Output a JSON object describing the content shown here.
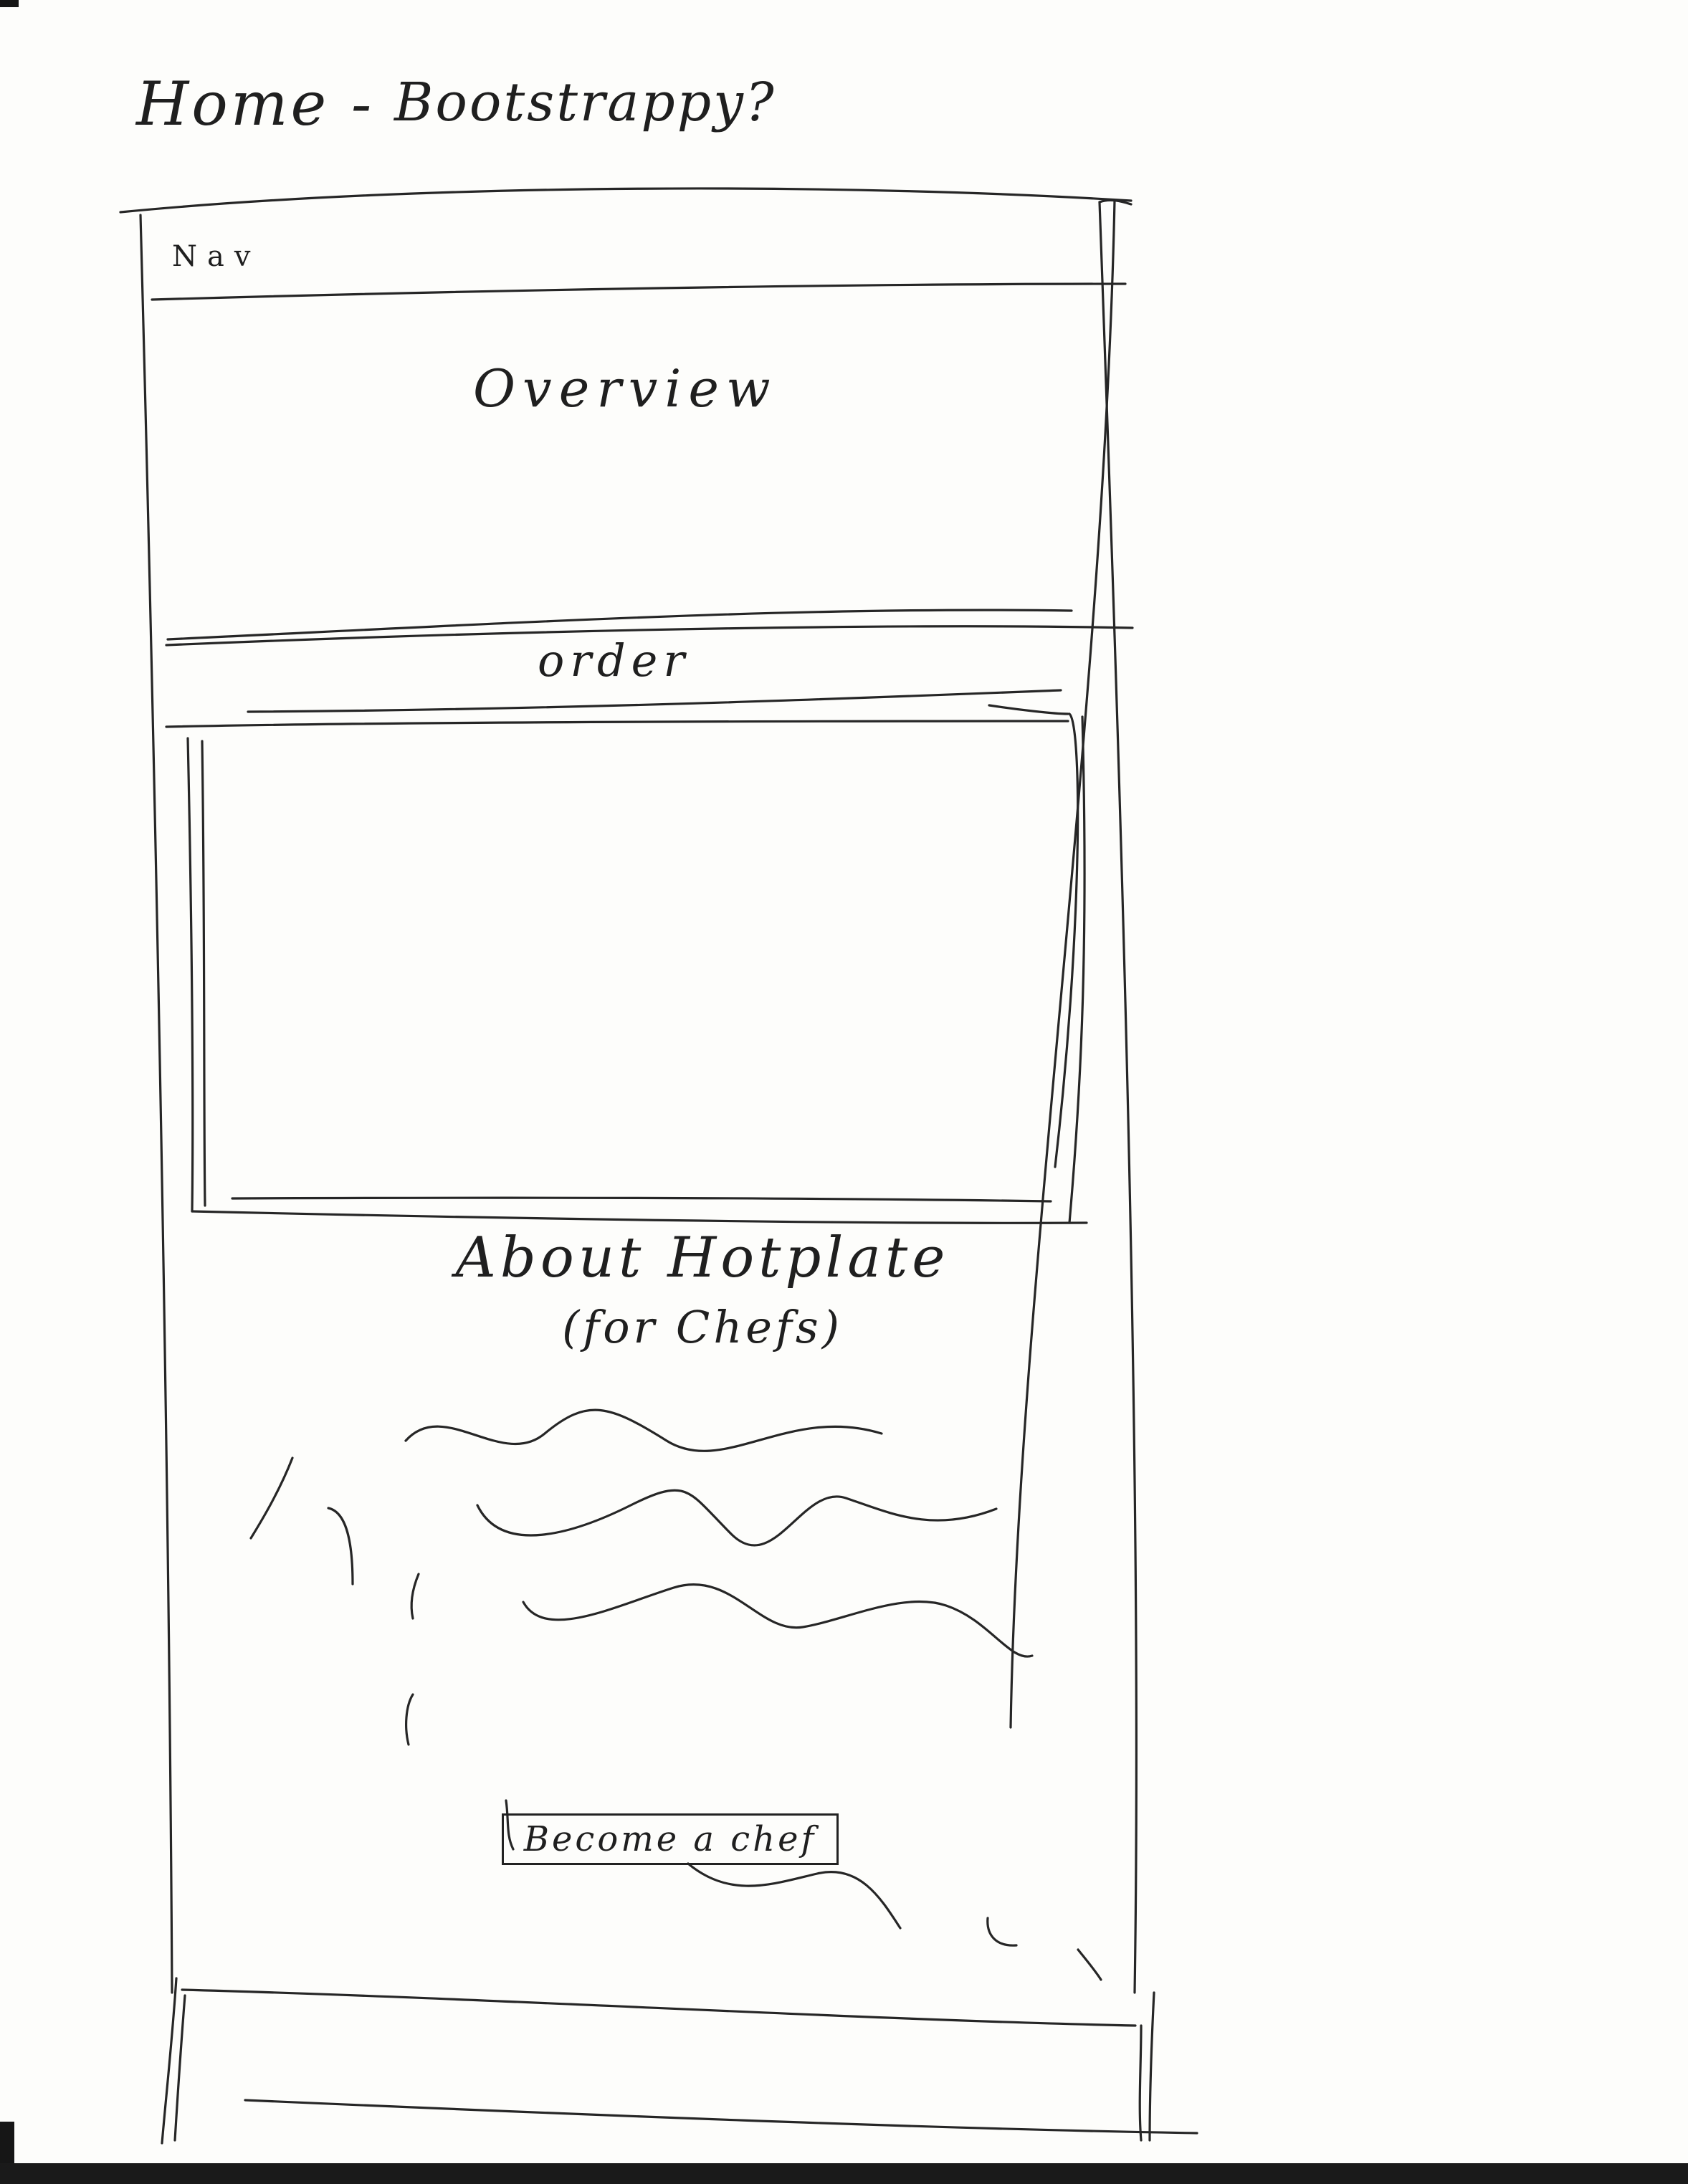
{
  "header": {
    "title": "Home -",
    "subtitle": "Bootstrappy?"
  },
  "nav": {
    "label": "Nav"
  },
  "overview": {
    "label": "Overview"
  },
  "order": {
    "label": "order"
  },
  "about": {
    "title": "About Hotplate",
    "subtitle": "(for Chefs)"
  },
  "cta": {
    "label": "Become a chef"
  },
  "colors": {
    "paper": "#fdfdfb",
    "ink": "#262626"
  }
}
